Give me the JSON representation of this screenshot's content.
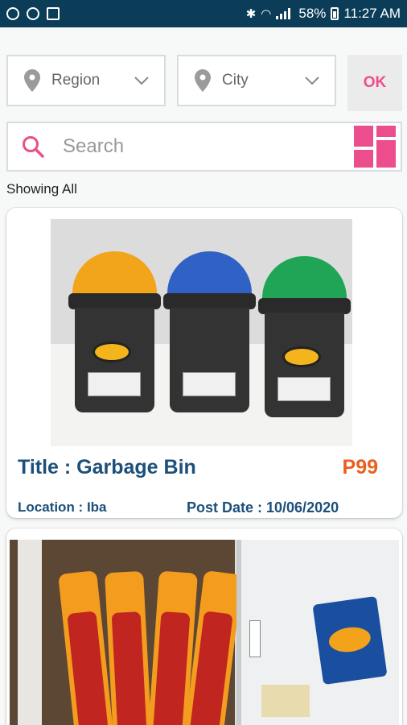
{
  "status_bar": {
    "battery": "58%",
    "time": "11:27 AM",
    "left_icons": [
      "link-icon",
      "target-icon",
      "clipboard-icon"
    ]
  },
  "filters": {
    "region_label": "Region",
    "city_label": "City",
    "ok_label": "OK"
  },
  "search": {
    "placeholder": "Search"
  },
  "showing_text": "Showing All",
  "listings": [
    {
      "title": "Title : Garbage Bin",
      "price": "P99",
      "location": "Location : Iba",
      "post_date": "Post Date : 10/06/2020"
    }
  ],
  "colors": {
    "status_bar": "#0b3d58",
    "accent_pink": "#ec4d8c",
    "title_blue": "#1c4f7a",
    "price_orange": "#e95f1e"
  }
}
